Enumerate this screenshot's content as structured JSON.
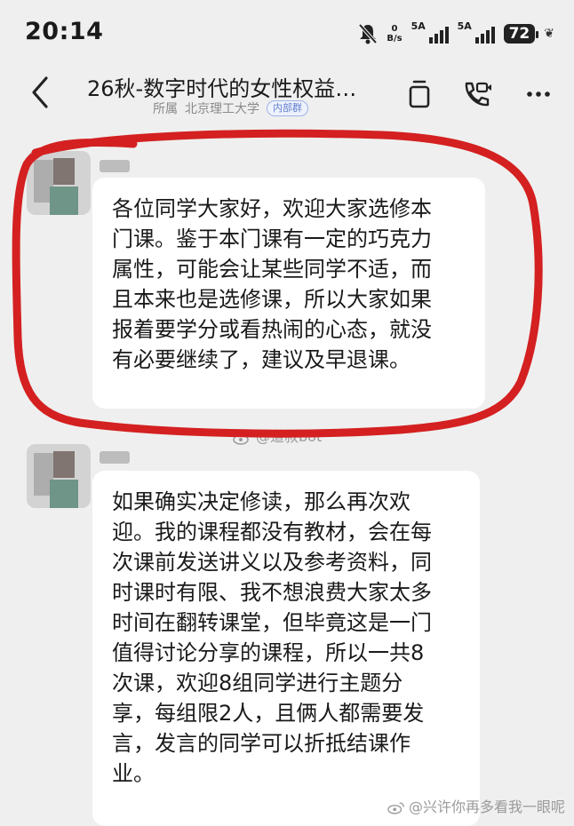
{
  "status_bar": {
    "time": "20:14",
    "net_speed_value": "0",
    "net_speed_unit": "B/s",
    "signal_1_label": "5A",
    "signal_2_label": "5A",
    "battery": "72",
    "icons": [
      "mute-icon",
      "signal-icon",
      "battery-icon",
      "leaf-icon"
    ]
  },
  "header": {
    "title": "26秋-数字时代的女性权益…",
    "affiliation_prefix": "所属",
    "affiliation": "北京理工大学",
    "group_badge": "内部群",
    "icons": [
      "back-icon",
      "notes-icon",
      "video-call-icon",
      "more-icon"
    ]
  },
  "messages": [
    {
      "lines": [
        "各位同学大家好，欢迎大家选修本",
        "门课。鉴于本门课有一定的巧克力",
        "属性，可能会让某些同学不适，而",
        "且本来也是选修课，所以大家如果",
        "报着要学分或看热闹的心态，就没",
        "有必要继续了，建议及早退课。"
      ]
    },
    {
      "lines": [
        "如果确实决定修读，那么再次欢",
        "迎。我的课程都没有教材，会在每",
        "次课前发送讲义以及参考资料，同",
        "时课时有限、我不想浪费大家太多",
        "时间在翻转课堂，但毕竟这是一门",
        "值得讨论分享的课程，所以一共8",
        "次课，欢迎8组同学进行主题分",
        "享，每组限2人，且俩人都需要发",
        "言，发言的同学可以折抵结课作",
        "业。"
      ]
    }
  ],
  "watermarks": {
    "middle": "@道叔bot",
    "bottom": "@兴许你再多看我一眼呢"
  },
  "annotation_color": "#d42020"
}
